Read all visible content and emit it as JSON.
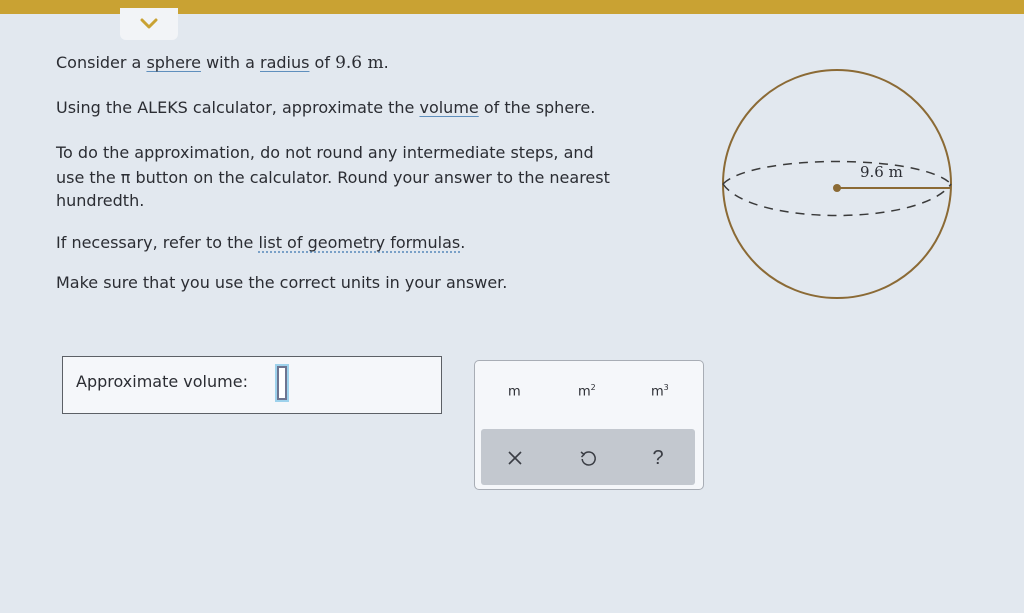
{
  "question": {
    "line1": {
      "pre": "Consider a ",
      "link1": "sphere",
      "mid": " with a ",
      "link2": "radius",
      "post1": " of ",
      "value": "9.6 m",
      "end": "."
    },
    "line2": {
      "pre": "Using the ALEKS calculator, approximate the ",
      "link": "volume",
      "post": " of the sphere."
    },
    "para3_line1": "To do the approximation, do not round any intermediate steps, and",
    "para3_line2": "use the π button on the calculator. Round your answer to the nearest",
    "para3_line3": "hundredth.",
    "line4": {
      "pre": "If necessary, refer to the ",
      "link": "list of geometry formulas",
      "post": "."
    },
    "line5": "Make sure that you use the correct units in your answer."
  },
  "figure": {
    "radius_label": "9.6 m",
    "stroke_color": "#8b6a35"
  },
  "answer": {
    "label": "Approximate volume:",
    "value": ""
  },
  "units": [
    {
      "base": "m",
      "exp": ""
    },
    {
      "base": "m",
      "exp": "2"
    },
    {
      "base": "m",
      "exp": "3"
    }
  ],
  "actions": {
    "clear": "×",
    "undo": "↺",
    "help": "?"
  },
  "colors": {
    "top_bar": "#c9a233",
    "accent_link": "#5f8fbd",
    "background": "#e2e8ef"
  },
  "icons": {
    "collapse": "chevron-down-icon",
    "clear": "close-icon",
    "undo": "undo-icon",
    "help": "help-icon"
  }
}
